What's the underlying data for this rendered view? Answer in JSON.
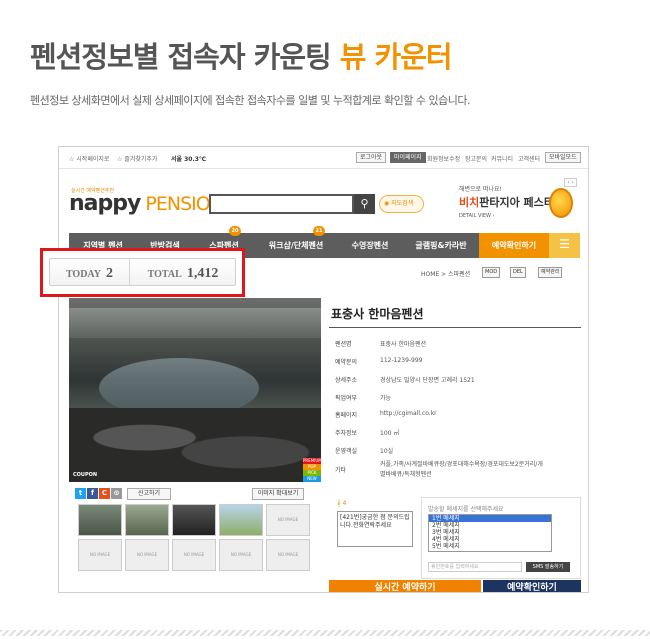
{
  "heading": {
    "main": "펜션정보별 접속자 카운팅 ",
    "highlight": "뷰 카운터"
  },
  "subheading": "펜션정보 상세화면에서 실제 상세페이지에 접속한 접속자수를 일별 및 누적합계로 확인할 수 있습니다.",
  "topbar": {
    "left": [
      "☆ 시작페이지로",
      "☆ 즐겨찾기추가"
    ],
    "weather": "서울 30.3℃",
    "buttons": [
      "로그아웃",
      "마이페이지",
      "회원정보수정",
      "장고문의",
      "커뮤니티",
      "고객센터",
      "모바일모드"
    ]
  },
  "logo": {
    "tagline": "실시간 예약펜션추천 ",
    "name": "nappy",
    "suffix": " PENSION"
  },
  "search": {
    "placeholder": "",
    "map_label": "◉ 지도검색"
  },
  "banner": {
    "line1": "해변으로 떠나요!",
    "line2a": "비치",
    "line2b": "판타지아 페스티벌",
    "line3": "DETAIL VIEW ›",
    "arrows": "‹ ›"
  },
  "nav": {
    "items": [
      "지역별 펜션",
      "반방검색",
      "스파펜션",
      "워크샵/단체펜션",
      "수영장펜션",
      "글램핑&카라반",
      "예약확인하기"
    ],
    "badges": [
      "20",
      "21"
    ],
    "menu_icon": "☰"
  },
  "counter": {
    "today_label": "TODAY",
    "today_value": "2",
    "total_label": "TOTAL",
    "total_value": "1,412"
  },
  "breadcrumb": "HOME > 스파펜션",
  "action_buttons": [
    "MOD",
    "DEL",
    "예약관리"
  ],
  "photo": {
    "coupon": "COUPON",
    "tags": [
      "PREMIUM",
      "POP",
      "PICK",
      "NEW"
    ]
  },
  "share": {
    "icons": [
      "t",
      "f",
      "C",
      "⊙"
    ],
    "report": "신고하기",
    "zoom": "이미지 확대보기"
  },
  "thumbs": {
    "no_image": "NO IMAGE"
  },
  "detail": {
    "title": "표충사 한마음펜션",
    "rows": [
      {
        "label": "펜션명",
        "value": "표충사 한마음펜션"
      },
      {
        "label": "예약문의",
        "value": "112-1239-999"
      },
      {
        "label": "상세주소",
        "value": "경상남도 밀양시 단장면 고례리 1521"
      },
      {
        "label": "픽업여부",
        "value": "가능"
      },
      {
        "label": "홈페이지",
        "value": "http://cgimall.co.kr"
      },
      {
        "label": "주차정보",
        "value": "100 ㎡"
      },
      {
        "label": "운영객실",
        "value": "10실"
      },
      {
        "label": "기타",
        "value": "커플,가족/사계절바베큐장/경포대해수욕장/경포대도보2분거리/개",
        "value2": "별바베큐/독채형펜션"
      }
    ]
  },
  "qr": {
    "label": "𝄞 4",
    "text": "[421번]궁금한 점 문의드립니다.전화연락주세요"
  },
  "sms": {
    "title": "발송할 메세지를 선택해주세요",
    "options": [
      "1번 메세지",
      "2번 메세지",
      "3번 메세지",
      "4번 메세지",
      "5번 메세지"
    ],
    "input_placeholder": "휴인번호를 입력하세요",
    "send": "SMS 발송하기"
  },
  "booking": {
    "left": "실시간 예약하기",
    "right": "예약확인하기"
  },
  "colors": {
    "accent": "#f39200",
    "highlight_frame": "#e2151a",
    "nav_bg": "#5d5d5d"
  }
}
